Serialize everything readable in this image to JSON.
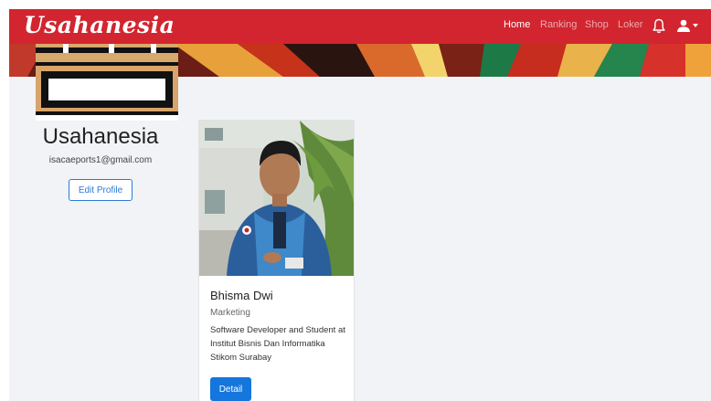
{
  "navbar": {
    "brand": "Usahanesia",
    "links": [
      {
        "label": "Home",
        "active": true
      },
      {
        "label": "Ranking",
        "active": false
      },
      {
        "label": "Shop",
        "active": false
      },
      {
        "label": "Loker",
        "active": false
      }
    ],
    "icons": [
      "bell-icon",
      "user-icon",
      "caret-down-icon"
    ]
  },
  "profile": {
    "name": "Usahanesia",
    "email": "isacaeports1@gmail.com",
    "edit_label": "Edit Profile"
  },
  "member": {
    "name": "Bhisma Dwi",
    "role": "Marketing",
    "bio": "Software Developer and Student at Institut Bisnis Dan Informatika Stikom Surabay",
    "detail_label": "Detail"
  },
  "colors": {
    "navbar": "#d2252f",
    "primary": "#1576dd",
    "background": "#f1f3f6"
  }
}
